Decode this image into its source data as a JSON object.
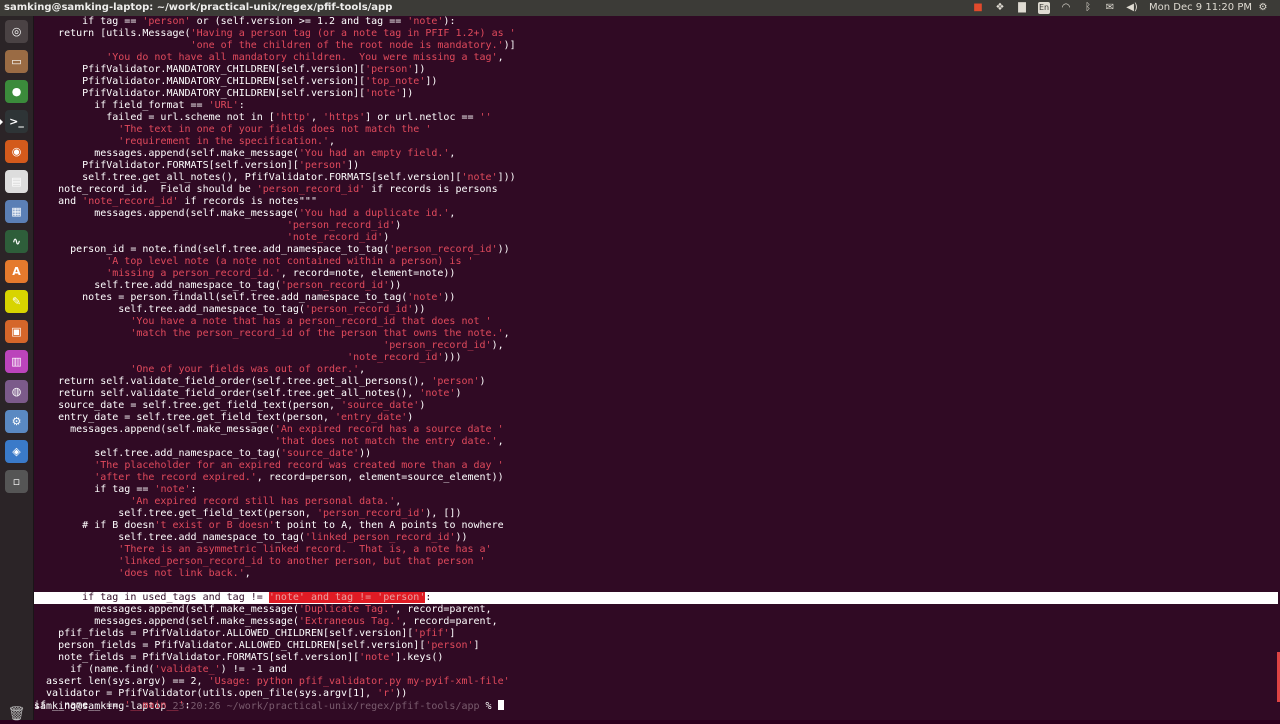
{
  "window": {
    "title": "samking@samking-laptop: ~/work/practical-unix/regex/pfif-tools/app"
  },
  "tray": {
    "lang": "En",
    "clock": "Mon Dec  9 11:20 PM"
  },
  "launcher": {
    "items": [
      {
        "name": "dash-home",
        "glyph": "◎",
        "color": "#4a4244"
      },
      {
        "name": "files",
        "glyph": "▭",
        "color": "#9a6b44"
      },
      {
        "name": "chrome",
        "glyph": "●",
        "color": "#3b8b3b"
      },
      {
        "name": "terminal",
        "glyph": ">_",
        "color": "#2e3436"
      },
      {
        "name": "firefox",
        "glyph": "◉",
        "color": "#d35a1c"
      },
      {
        "name": "text-editor",
        "glyph": "▤",
        "color": "#ddd"
      },
      {
        "name": "document",
        "glyph": "▦",
        "color": "#5b7fb5"
      },
      {
        "name": "system-monitor",
        "glyph": "∿",
        "color": "#2e5e3a"
      },
      {
        "name": "software-center",
        "glyph": "A",
        "color": "#e57a2d"
      },
      {
        "name": "sticky-tool",
        "glyph": "✎",
        "color": "#d8d400"
      },
      {
        "name": "impress",
        "glyph": "▣",
        "color": "#d5662a"
      },
      {
        "name": "calc",
        "glyph": "▥",
        "color": "#bb44bb"
      },
      {
        "name": "disk-utility",
        "glyph": "◍",
        "color": "#7b5a8a"
      },
      {
        "name": "settings",
        "glyph": "⚙",
        "color": "#5a89c2"
      },
      {
        "name": "network",
        "glyph": "◈",
        "color": "#3a7ac9"
      },
      {
        "name": "workspace",
        "glyph": "▫",
        "color": "#555"
      }
    ],
    "trash": "🗑"
  },
  "terminal": {
    "lines": [
      [
        [
          "        if tag == ",
          ""
        ],
        [
          "'person'",
          "s"
        ],
        [
          " or (self.version >= 1.2 and tag == ",
          ""
        ],
        [
          "'note'",
          "s"
        ],
        [
          "):",
          ""
        ]
      ],
      [
        [
          "    return [utils.Message(",
          ""
        ],
        [
          "'Having a person tag (or a note tag in PFIF 1.2+) as '",
          "s"
        ]
      ],
      [
        [
          "                          ",
          ""
        ],
        [
          "'one of the children of the root node is mandatory.'",
          "s"
        ],
        [
          ")]",
          ""
        ]
      ],
      [
        [
          "            ",
          ""
        ],
        [
          "'You do not have all mandatory children.  You were missing a tag'",
          "s"
        ],
        [
          ",",
          ""
        ]
      ],
      [
        [
          "        PfifValidator.MANDATORY_CHILDREN[self.version][",
          ""
        ],
        [
          "'person'",
          "s"
        ],
        [
          "])",
          ""
        ]
      ],
      [
        [
          "        PfifValidator.MANDATORY_CHILDREN[self.version][",
          ""
        ],
        [
          "'top_note'",
          "s"
        ],
        [
          "])",
          ""
        ]
      ],
      [
        [
          "        PfifValidator.MANDATORY_CHILDREN[self.version][",
          ""
        ],
        [
          "'note'",
          "s"
        ],
        [
          "])",
          ""
        ]
      ],
      [
        [
          "          if field_format == ",
          ""
        ],
        [
          "'URL'",
          "s"
        ],
        [
          ":",
          ""
        ]
      ],
      [
        [
          "            failed = url.scheme not in [",
          ""
        ],
        [
          "'http'",
          "s"
        ],
        [
          ", ",
          ""
        ],
        [
          "'https'",
          "s"
        ],
        [
          "] or url.netloc == ",
          ""
        ],
        [
          "''",
          "s"
        ]
      ],
      [
        [
          "              ",
          ""
        ],
        [
          "'The text in one of your fields does not match the '",
          "s"
        ]
      ],
      [
        [
          "              ",
          ""
        ],
        [
          "'requirement in the specification.'",
          "s"
        ],
        [
          ",",
          ""
        ]
      ],
      [
        [
          "          messages.append(self.make_message(",
          ""
        ],
        [
          "'You had an empty field.'",
          "s"
        ],
        [
          ",",
          ""
        ]
      ],
      [
        [
          "        PfifValidator.FORMATS[self.version][",
          ""
        ],
        [
          "'person'",
          "s"
        ],
        [
          "])",
          ""
        ]
      ],
      [
        [
          "        self.tree.get_all_notes(), PfifValidator.FORMATS[self.version][",
          ""
        ],
        [
          "'note'",
          "s"
        ],
        [
          "]))",
          ""
        ]
      ],
      [
        [
          "    note_record_id.  Field should be ",
          ""
        ],
        [
          "'person_record_id'",
          "s"
        ],
        [
          " if records is persons",
          ""
        ]
      ],
      [
        [
          "    and ",
          ""
        ],
        [
          "'note_record_id'",
          "s"
        ],
        [
          " if records is notes\"\"\"",
          ""
        ]
      ],
      [
        [
          "          messages.append(self.make_message(",
          ""
        ],
        [
          "'You had a duplicate id.'",
          "s"
        ],
        [
          ",",
          ""
        ]
      ],
      [
        [
          "                                          ",
          ""
        ],
        [
          "'person_record_id'",
          "s"
        ],
        [
          ")",
          ""
        ]
      ],
      [
        [
          "                                          ",
          ""
        ],
        [
          "'note_record_id'",
          "s"
        ],
        [
          ")",
          ""
        ]
      ],
      [
        [
          "      person_id = note.find(self.tree.add_namespace_to_tag(",
          ""
        ],
        [
          "'person_record_id'",
          "s"
        ],
        [
          "))",
          ""
        ]
      ],
      [
        [
          "            ",
          ""
        ],
        [
          "'A top level note (a note not contained within a person) is '",
          "s"
        ]
      ],
      [
        [
          "            ",
          ""
        ],
        [
          "'missing a person_record_id.'",
          "s"
        ],
        [
          ", record=note, element=note))",
          ""
        ]
      ],
      [
        [
          "          self.tree.add_namespace_to_tag(",
          ""
        ],
        [
          "'person_record_id'",
          "s"
        ],
        [
          "))",
          ""
        ]
      ],
      [
        [
          "        notes = person.findall(self.tree.add_namespace_to_tag(",
          ""
        ],
        [
          "'note'",
          "s"
        ],
        [
          "))",
          ""
        ]
      ],
      [
        [
          "              self.tree.add_namespace_to_tag(",
          ""
        ],
        [
          "'person_record_id'",
          "s"
        ],
        [
          "))",
          ""
        ]
      ],
      [
        [
          "                ",
          ""
        ],
        [
          "'You have a note that has a person_record_id that does not '",
          "s"
        ]
      ],
      [
        [
          "                ",
          ""
        ],
        [
          "'match the person_record_id of the person that owns the note.'",
          "s"
        ],
        [
          ",",
          ""
        ]
      ],
      [
        [
          "                                                          ",
          ""
        ],
        [
          "'person_record_id'",
          "s"
        ],
        [
          "),",
          ""
        ]
      ],
      [
        [
          "                                                    ",
          ""
        ],
        [
          "'note_record_id'",
          "s"
        ],
        [
          ")))",
          ""
        ]
      ],
      [
        [
          "                ",
          ""
        ],
        [
          "'One of your fields was out of order.'",
          "s"
        ],
        [
          ",",
          ""
        ]
      ],
      [
        [
          "    return self.validate_field_order(self.tree.get_all_persons(), ",
          ""
        ],
        [
          "'person'",
          "s"
        ],
        [
          ")",
          ""
        ]
      ],
      [
        [
          "    return self.validate_field_order(self.tree.get_all_notes(), ",
          ""
        ],
        [
          "'note'",
          "s"
        ],
        [
          ")",
          ""
        ]
      ],
      [
        [
          "    source_date = self.tree.get_field_text(person, ",
          ""
        ],
        [
          "'source_date'",
          "s"
        ],
        [
          ")",
          ""
        ]
      ],
      [
        [
          "    entry_date = self.tree.get_field_text(person, ",
          ""
        ],
        [
          "'entry_date'",
          "s"
        ],
        [
          ")",
          ""
        ]
      ],
      [
        [
          "      messages.append(self.make_message(",
          ""
        ],
        [
          "'An expired record has a source date '",
          "s"
        ]
      ],
      [
        [
          "                                        ",
          ""
        ],
        [
          "'that does not match the entry date.'",
          "s"
        ],
        [
          ",",
          ""
        ]
      ],
      [
        [
          "          self.tree.add_namespace_to_tag(",
          ""
        ],
        [
          "'source_date'",
          "s"
        ],
        [
          "))",
          ""
        ]
      ],
      [
        [
          "          ",
          ""
        ],
        [
          "'The placeholder for an expired record was created more than a day '",
          "s"
        ]
      ],
      [
        [
          "          ",
          ""
        ],
        [
          "'after the record expired.'",
          "s"
        ],
        [
          ", record=person, element=source_element))",
          ""
        ]
      ],
      [
        [
          "          if tag == ",
          ""
        ],
        [
          "'note'",
          "s"
        ],
        [
          ":",
          ""
        ]
      ],
      [
        [
          "                ",
          ""
        ],
        [
          "'An expired record still has personal data.'",
          "s"
        ],
        [
          ",",
          ""
        ]
      ],
      [
        [
          "              self.tree.get_field_text(person, ",
          ""
        ],
        [
          "'person_record_id'",
          "s"
        ],
        [
          "), [])",
          ""
        ]
      ],
      [
        [
          "        # if B doesn",
          ""
        ],
        [
          "'t exist or B doesn'",
          "s"
        ],
        [
          "t point to A, then A points to nowhere",
          ""
        ]
      ],
      [
        [
          "              self.tree.add_namespace_to_tag(",
          ""
        ],
        [
          "'linked_person_record_id'",
          "s"
        ],
        [
          "))",
          ""
        ]
      ],
      [
        [
          "              ",
          ""
        ],
        [
          "'There is an asymmetric linked record.  That is, a note has a'",
          "s"
        ]
      ],
      [
        [
          "              ",
          ""
        ],
        [
          "'linked_person_record_id to another person, but that person '",
          "s"
        ]
      ],
      [
        [
          "              ",
          ""
        ],
        [
          "'does not link back.'",
          "s"
        ],
        [
          ",",
          ""
        ]
      ]
    ],
    "highlight_pre": "        if tag in used_tags and tag != ",
    "highlight_sel": "'note' and tag != 'person'",
    "highlight_post": ":",
    "lines_after": [
      [
        [
          "          messages.append(self.make_message(",
          ""
        ],
        [
          "'Duplicate Tag.'",
          "s"
        ],
        [
          ", record=parent,",
          ""
        ]
      ],
      [
        [
          "          messages.append(self.make_message(",
          ""
        ],
        [
          "'Extraneous Tag.'",
          "s"
        ],
        [
          ", record=parent,",
          ""
        ]
      ],
      [
        [
          "    pfif_fields = PfifValidator.ALLOWED_CHILDREN[self.version][",
          ""
        ],
        [
          "'pfif'",
          "s"
        ],
        [
          "]",
          ""
        ]
      ],
      [
        [
          "    person_fields = PfifValidator.ALLOWED_CHILDREN[self.version][",
          ""
        ],
        [
          "'person'",
          "s"
        ],
        [
          "]",
          ""
        ]
      ],
      [
        [
          "    note_fields = PfifValidator.FORMATS[self.version][",
          ""
        ],
        [
          "'note'",
          "s"
        ],
        [
          "].keys()",
          ""
        ]
      ],
      [
        [
          "      if (name.find(",
          ""
        ],
        [
          "'validate_'",
          "s"
        ],
        [
          ") != -1 and",
          ""
        ]
      ],
      [
        [
          "  assert len(sys.argv) == 2, ",
          ""
        ],
        [
          "'Usage: python pfif_validator.py my-pyif-xml-file'",
          "s"
        ]
      ],
      [
        [
          "  validator = PfifValidator(utils.open_file(sys.argv[1], ",
          ""
        ],
        [
          "'r'",
          "s"
        ],
        [
          "))",
          ""
        ]
      ],
      [
        [
          "if __name__ == ",
          ""
        ],
        [
          "'__main__'",
          "s"
        ],
        [
          ":",
          ""
        ]
      ]
    ],
    "prompt_user": "samking@samking-laptop",
    "prompt_time": " 23:20:26",
    "prompt_path": " ~/work/practical-unix/regex/pfif-tools/app",
    "prompt_char": " % "
  }
}
